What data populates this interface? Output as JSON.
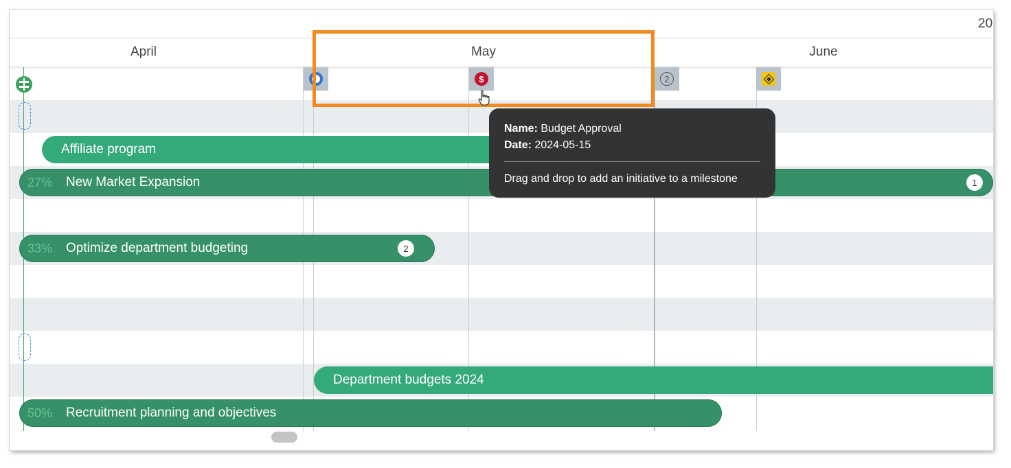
{
  "timeline": {
    "year_label": "20",
    "months": [
      "April",
      "May",
      "June"
    ]
  },
  "milestones": {
    "count_badge": "2",
    "red_symbol": "$"
  },
  "initiatives": [
    {
      "name": "Affiliate program",
      "percent": "",
      "badge": ""
    },
    {
      "name": "New Market Expansion",
      "percent": "27%",
      "badge": "1"
    },
    {
      "name": "Optimize department budgeting",
      "percent": "33%",
      "badge": "2"
    },
    {
      "name": "Department budgets 2024",
      "percent": "",
      "badge": ""
    },
    {
      "name": "Recruitment planning and objectives",
      "percent": "50%",
      "badge": ""
    }
  ],
  "tooltip": {
    "name_label": "Name:",
    "name_value": "Budget Approval",
    "date_label": "Date:",
    "date_value": "2024-05-15",
    "hint": "Drag and drop to add an initiative to a milestone"
  },
  "colors": {
    "bar_light": "#34a97a",
    "bar_dark": "#369168",
    "highlight": "#f28a1d",
    "tooltip_bg": "#333333",
    "milestone_red": "#c4122f",
    "milestone_blue": "#2f74d0",
    "milestone_yellow": "#f2c417"
  },
  "icons": [
    "today-marker-icon",
    "milestone-blue-icon",
    "milestone-dollar-icon",
    "milestone-count-icon",
    "milestone-diamond-icon",
    "hand-cursor-icon"
  ]
}
